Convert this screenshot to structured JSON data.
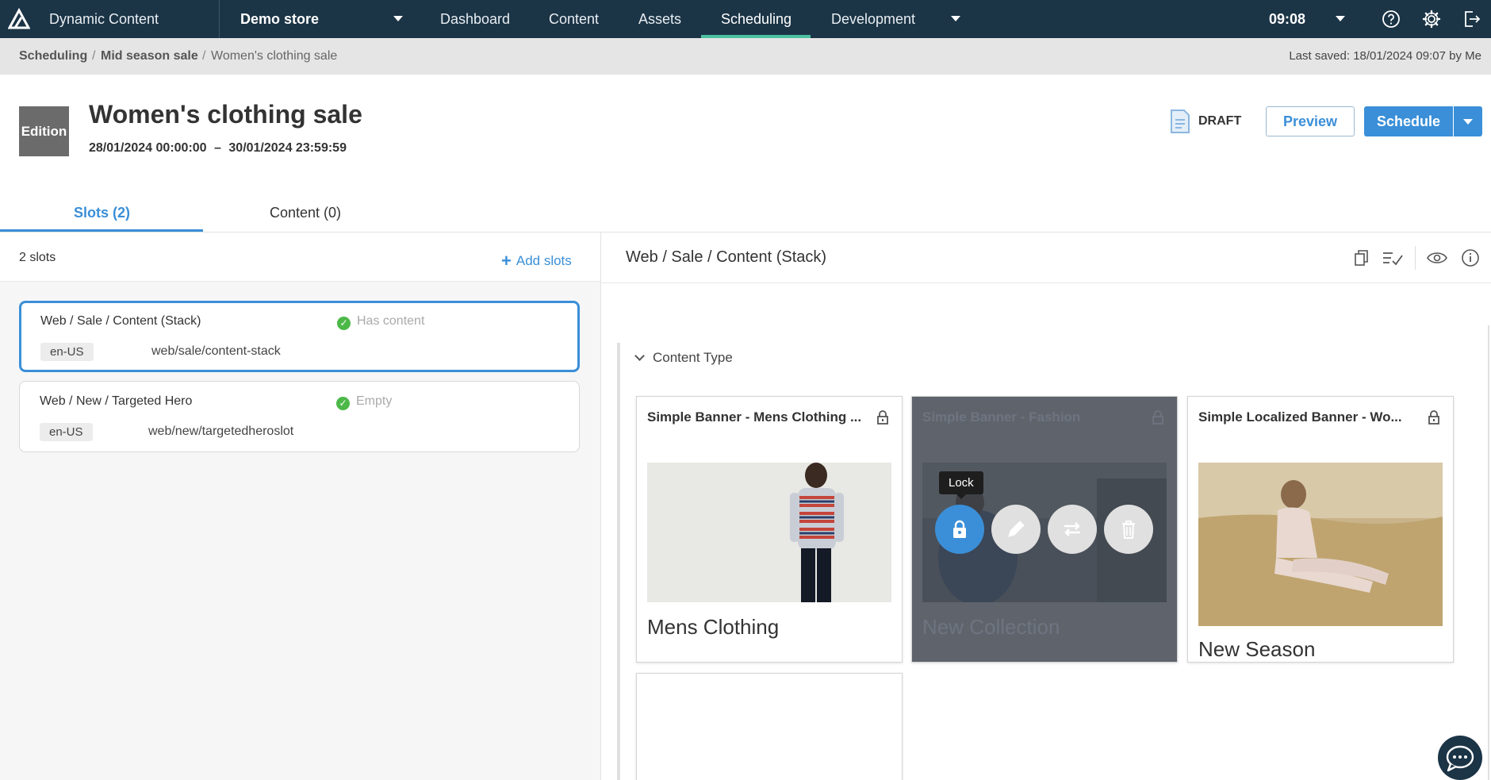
{
  "topnav": {
    "app_name": "Dynamic Content",
    "store": "Demo store",
    "items": [
      "Dashboard",
      "Content",
      "Assets",
      "Scheduling",
      "Development"
    ],
    "active": "Scheduling",
    "time": "09:08",
    "icons": [
      "help-icon",
      "gear-icon",
      "logout-icon"
    ]
  },
  "breadcrumb": {
    "items": [
      "Scheduling",
      "Mid season sale",
      "Women's clothing sale"
    ],
    "separator": "/",
    "last_saved": "Last saved: 18/01/2024 09:07 by Me"
  },
  "edition": {
    "badge": "Edition",
    "title": "Women's clothing sale",
    "start": "28/01/2024 00:00:00",
    "dash": "–",
    "end": "30/01/2024 23:59:59",
    "status": "DRAFT",
    "preview_label": "Preview",
    "schedule_label": "Schedule"
  },
  "tabs": [
    {
      "label": "Slots (2)",
      "active": true
    },
    {
      "label": "Content (0)",
      "active": false
    }
  ],
  "slots_panel": {
    "count": "2 slots",
    "add_label": "Add slots",
    "slots": [
      {
        "name": "Web / Sale / Content (Stack)",
        "status": "Has content",
        "locale": "en-US",
        "path": "web/sale/content-stack",
        "selected": true
      },
      {
        "name": "Web / New / Targeted Hero",
        "status": "Empty",
        "locale": "en-US",
        "path": "web/new/targetedheroslot",
        "selected": false
      }
    ]
  },
  "detail": {
    "title": "Web / Sale / Content (Stack)",
    "section_label": "Content Type",
    "cards": [
      {
        "title": "Simple Banner - Mens Clothing ...",
        "caption": "Mens Clothing"
      },
      {
        "title": "Simple Banner - Fashion",
        "caption": "New Collection",
        "tooltip": "Lock"
      },
      {
        "title": "Simple Localized Banner - Wo...",
        "caption": "New Season"
      }
    ]
  },
  "colors": {
    "nav_bg": "#1b3446",
    "accent": "#3a8fd8",
    "active_tab_indicator": "#4bc0a0",
    "success": "#4cb848"
  }
}
